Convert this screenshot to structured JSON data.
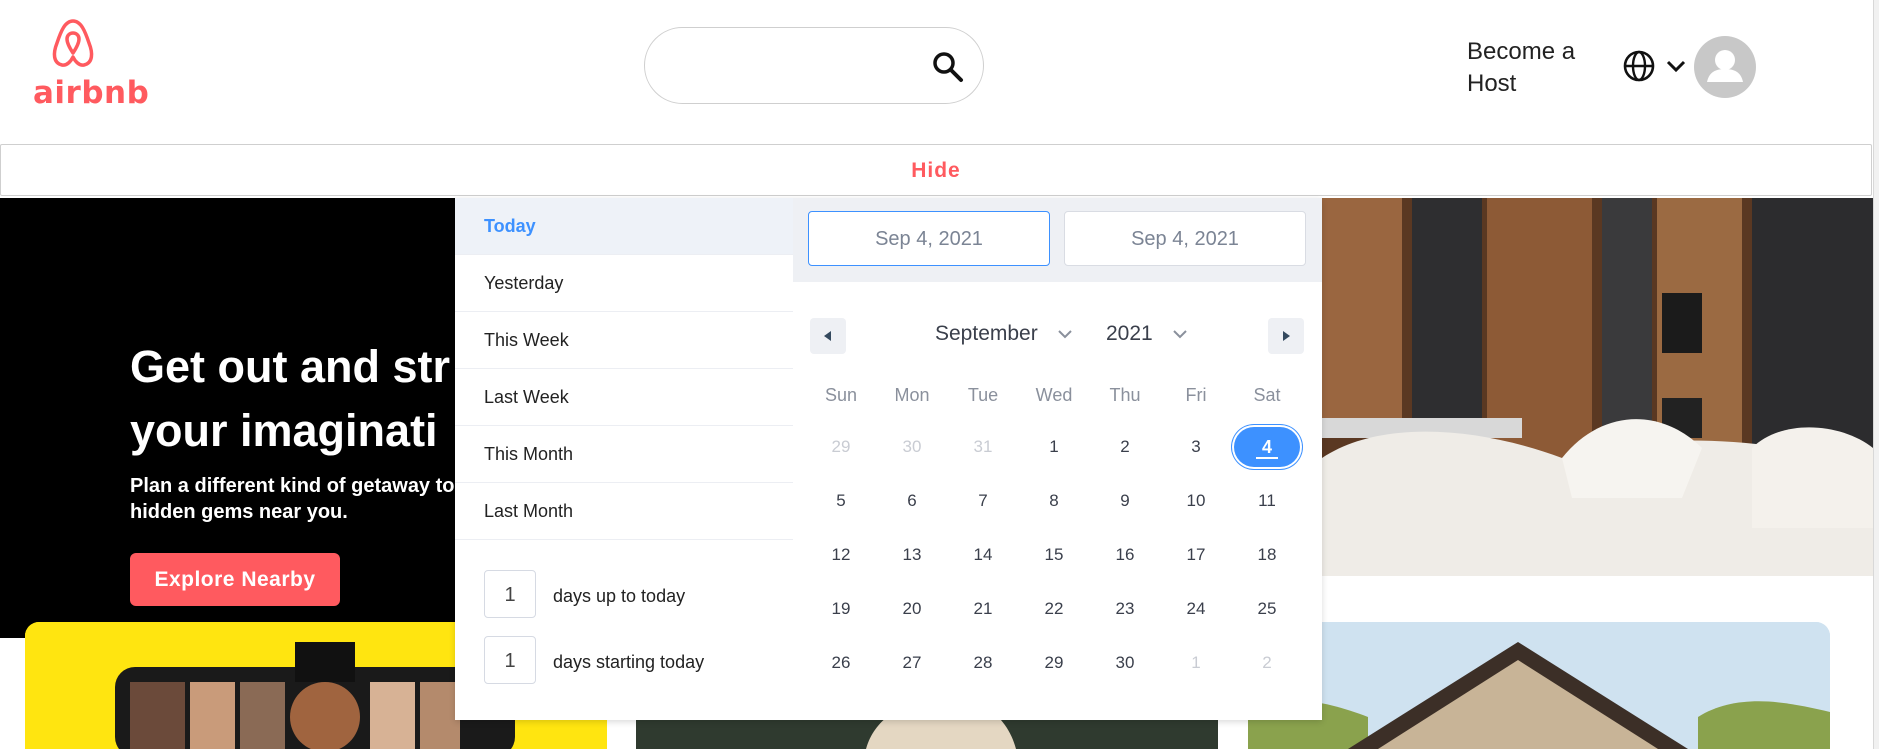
{
  "header": {
    "logo_text": "airbnb",
    "become_host": "Become a Host",
    "brand_color": "#ff5a5f",
    "icons": [
      "search-icon",
      "globe-icon",
      "chevron-down-icon",
      "user-avatar-icon"
    ]
  },
  "hide_bar": {
    "label": "Hide"
  },
  "hero": {
    "title": "Get out and str\nyour imaginati",
    "subtitle": "Plan a different kind of getaway to\nhidden gems near you.",
    "cta": "Explore Nearby"
  },
  "picker": {
    "accent": "#3d91ff",
    "ranges": [
      {
        "label": "Today",
        "active": true
      },
      {
        "label": "Yesterday",
        "active": false
      },
      {
        "label": "This Week",
        "active": false
      },
      {
        "label": "Last Week",
        "active": false
      },
      {
        "label": "This Month",
        "active": false
      },
      {
        "label": "Last Month",
        "active": false
      }
    ],
    "inputs": [
      {
        "value": "1",
        "label": "days up to today"
      },
      {
        "value": "1",
        "label": "days starting today"
      }
    ],
    "start_date": "Sep 4, 2021",
    "end_date": "Sep 4, 2021",
    "month": "September",
    "year": "2021",
    "weekdays": [
      "Sun",
      "Mon",
      "Tue",
      "Wed",
      "Thu",
      "Fri",
      "Sat"
    ],
    "weeks": [
      [
        "29",
        "30",
        "31",
        "1",
        "2",
        "3",
        "4"
      ],
      [
        "5",
        "6",
        "7",
        "8",
        "9",
        "10",
        "11"
      ],
      [
        "12",
        "13",
        "14",
        "15",
        "16",
        "17",
        "18"
      ],
      [
        "19",
        "20",
        "21",
        "22",
        "23",
        "24",
        "25"
      ],
      [
        "26",
        "27",
        "28",
        "29",
        "30",
        "1",
        "2"
      ]
    ],
    "selected_day": "4"
  }
}
